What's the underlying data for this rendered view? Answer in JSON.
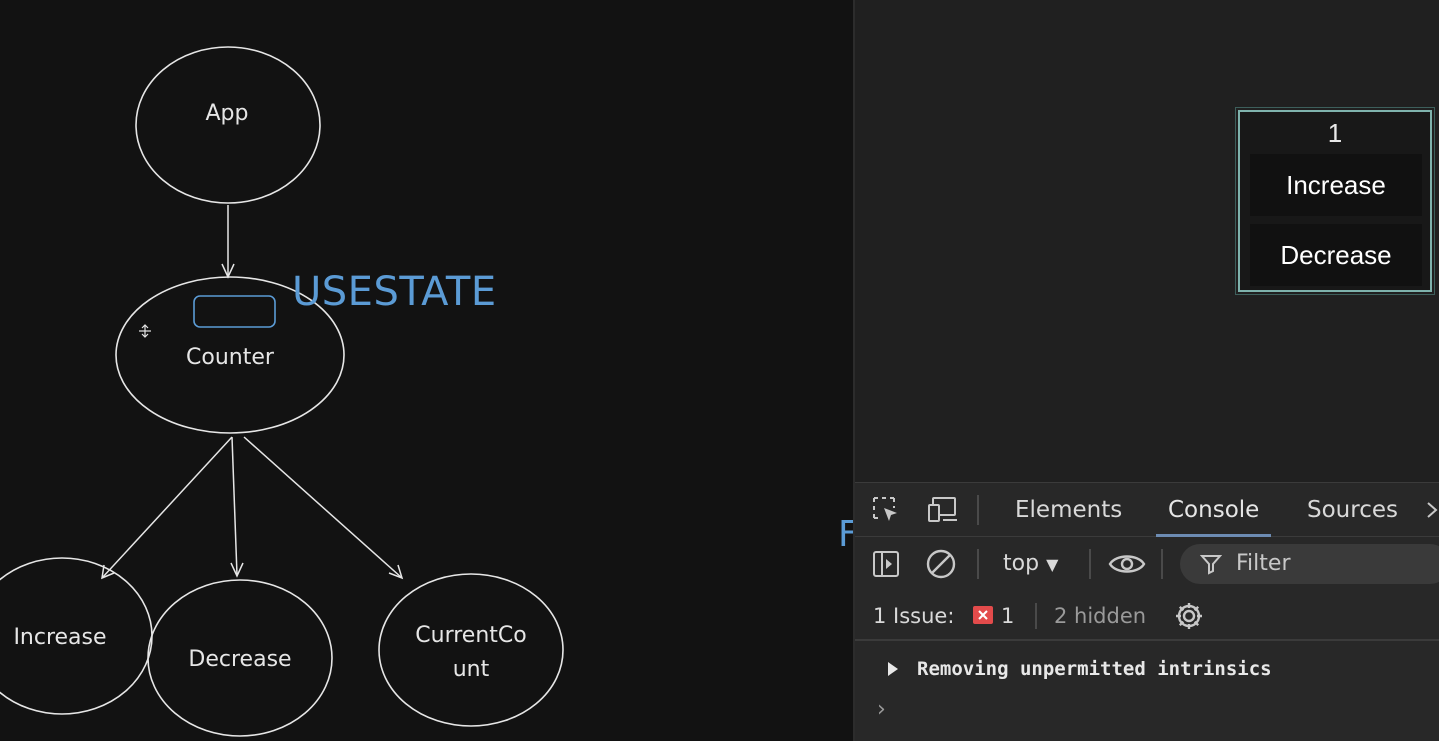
{
  "whiteboard": {
    "nodes": {
      "app": "App",
      "counter": "Counter",
      "increase": "Increase",
      "decrease": "Decrease",
      "current_count_line1": "CurrentCo",
      "current_count_line2": "unt"
    },
    "annotation": "USESTATE",
    "stray_letter": "F"
  },
  "preview": {
    "count": "1",
    "increase_label": "Increase",
    "decrease_label": "Decrease"
  },
  "devtools": {
    "tabs": [
      "Elements",
      "Console",
      "Sources"
    ],
    "active_tab": "Console",
    "context": "top",
    "filter_placeholder": "Filter",
    "issues_label": "1 Issue:",
    "issue_count": "1",
    "hidden_label": "2 hidden",
    "console_message": "Removing unpermitted intrinsics",
    "prompt_symbol": "›",
    "accent_color": "#6d8cb3",
    "error_color": "#e34b4b"
  }
}
